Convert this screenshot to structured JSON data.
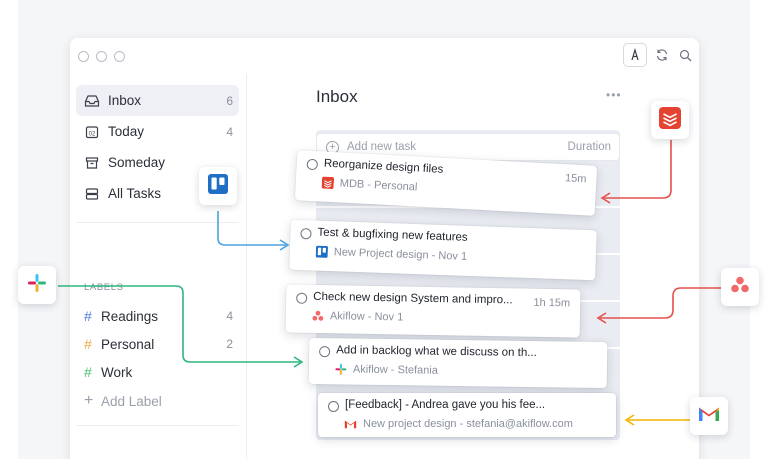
{
  "sidebar": {
    "items": [
      {
        "label": "Inbox",
        "count": "6",
        "icon": "inbox-icon"
      },
      {
        "label": "Today",
        "count": "4",
        "icon": "calendar-icon"
      },
      {
        "label": "Someday",
        "count": "",
        "icon": "archive-box-icon"
      },
      {
        "label": "All Tasks",
        "count": "",
        "icon": "stack-icon"
      }
    ],
    "labels_heading": "LABELS",
    "labels": [
      {
        "name": "Readings",
        "count": "4",
        "color": "#4a7bd6"
      },
      {
        "name": "Personal",
        "count": "2",
        "color": "#f0a545"
      },
      {
        "name": "Work",
        "count": "",
        "color": "#4fbf6a"
      }
    ],
    "add_label": "Add Label"
  },
  "main": {
    "title": "Inbox",
    "more": "•••",
    "add_task": {
      "placeholder": "Add new task",
      "duration_label": "Duration"
    }
  },
  "tasks": [
    {
      "title": "Reorganize design files",
      "source": "MDB",
      "project": "Personal",
      "date": "",
      "duration": "15m",
      "source_icon": "todoist-icon"
    },
    {
      "title": "Test & bugfixing new features",
      "source": "New Project design",
      "project": "",
      "date": "Nov 1",
      "duration": "",
      "source_icon": "trello-icon"
    },
    {
      "title": "Check new design System and impro...",
      "source": "Akiflow",
      "project": "",
      "date": "Nov 1",
      "duration": "1h 15m",
      "source_icon": "asana-icon"
    },
    {
      "title": "Add in backlog what we discuss on th...",
      "source": "Akiflow",
      "project": "Stefania",
      "date": "",
      "duration": "",
      "source_icon": "slack-icon"
    },
    {
      "title": "[Feedback] - Andrea gave you his fee...",
      "source": "New project design",
      "project": "stefania@akiflow.com",
      "date": "",
      "duration": "",
      "source_icon": "gmail-icon"
    }
  ],
  "integrations": [
    "todoist-icon",
    "trello-icon",
    "asana-icon",
    "slack-icon",
    "gmail-icon"
  ],
  "colors": {
    "todoist": "#e44332",
    "trello": "#1f6fc5",
    "asana": "#f06a6a",
    "slack_arrow": "#2eb67d",
    "gmail_arrow": "#f4b400",
    "trello_arrow": "#4aa3df",
    "red_arrow": "#e5504a"
  }
}
